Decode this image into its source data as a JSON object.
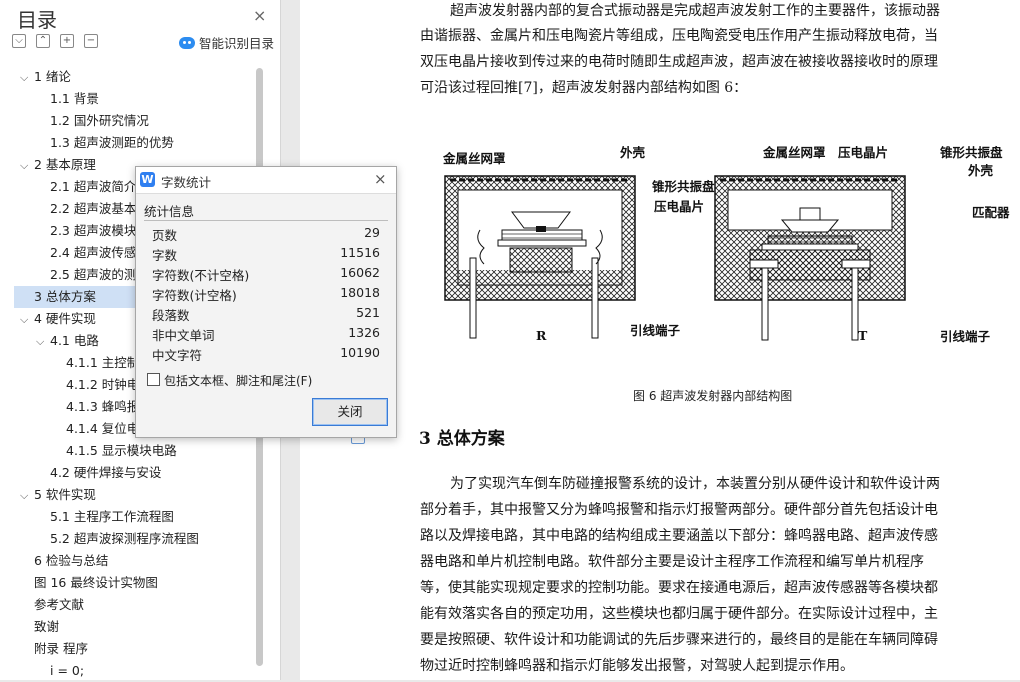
{
  "toc": {
    "title": "目录",
    "close_icon": "×",
    "smart_label": "智能识别目录",
    "tool_icons": [
      "⌵",
      "⌃",
      "+",
      "−"
    ],
    "items": [
      {
        "label": "1  绪论",
        "level": 1,
        "expanded": true
      },
      {
        "label": "1.1  背景",
        "level": 2
      },
      {
        "label": "1.2  国外研究情况",
        "level": 2
      },
      {
        "label": "1.3  超声波测距的优势",
        "level": 2
      },
      {
        "label": "2  基本原理",
        "level": 1,
        "expanded": true
      },
      {
        "label": "2.1  超声波简介",
        "level": 2
      },
      {
        "label": "2.2  超声波基本",
        "level": 2
      },
      {
        "label": "2.3  超声波模块",
        "level": 2
      },
      {
        "label": "2.4  超声波传感",
        "level": 2
      },
      {
        "label": "2.5  超声波的测",
        "level": 2
      },
      {
        "label": "3  总体方案",
        "level": 1,
        "selected": true
      },
      {
        "label": "4  硬件实现",
        "level": 1,
        "expanded": true
      },
      {
        "label": "4.1  电路",
        "level": 2,
        "expanded": true
      },
      {
        "label": "4.1.1  主控制",
        "level": 3
      },
      {
        "label": "4.1.2  时钟电",
        "level": 3
      },
      {
        "label": "4.1.3  蜂鸣报",
        "level": 3
      },
      {
        "label": "4.1.4  复位电",
        "level": 3
      },
      {
        "label": "4.1.5  显示模块电路",
        "level": 3
      },
      {
        "label": "4.2  硬件焊接与安设",
        "level": 2
      },
      {
        "label": "5  软件实现",
        "level": 1,
        "expanded": true
      },
      {
        "label": "5.1  主程序工作流程图",
        "level": 2
      },
      {
        "label": "5.2  超声波探测程序流程图",
        "level": 2
      },
      {
        "label": "6  检验与总结",
        "level": 1
      },
      {
        "label": "图 16  最终设计实物图",
        "level": 1
      },
      {
        "label": "参考文献",
        "level": 1
      },
      {
        "label": "致谢",
        "level": 1
      },
      {
        "label": "附录  程序",
        "level": 1
      },
      {
        "label": "i = 0;",
        "level": 2
      }
    ]
  },
  "dialog": {
    "title": "字数统计",
    "section": "统计信息",
    "stats": [
      {
        "label": "页数",
        "value": "29"
      },
      {
        "label": "字数",
        "value": "11516"
      },
      {
        "label": "字符数(不计空格)",
        "value": "16062"
      },
      {
        "label": "字符数(计空格)",
        "value": "18018"
      },
      {
        "label": "段落数",
        "value": "521"
      },
      {
        "label": "非中文单词",
        "value": "1326"
      },
      {
        "label": "中文字符",
        "value": "10190"
      }
    ],
    "checkbox_label": "包括文本框、脚注和尾注(F)",
    "checkbox_checked": false,
    "close_label": "关闭"
  },
  "document": {
    "intro_lines": [
      "超声波发射器内部的复合式振动器是完成超声波发射工作的主要器件，该振动器",
      "由谐振器、金属片和压电陶瓷片等组成，压电陶瓷受电压作用产生振动释放电荷，当",
      "双压电晶片接收到传过来的电荷时随即生成超声波，超声波在被接收器接收时的原理",
      "可沿该过程回推[7]，超声波发射器内部结构如图 6："
    ],
    "figure": {
      "left_labels": [
        "金属丝网罩",
        "外壳",
        "锥形共振盘",
        "压电晶片",
        "R",
        "引线端子"
      ],
      "right_labels": [
        "金属丝网罩",
        "压电晶片",
        "锥形共振盘",
        "外壳",
        "匹配器",
        "T",
        "引线端子"
      ]
    },
    "caption": "图 6  超声波发射器内部结构图",
    "heading": "3  总体方案",
    "body_lines": [
      "为了实现汽车倒车防碰撞报警系统的设计，本装置分别从硬件设计和软件设计两",
      "部分着手，其中报警又分为蜂鸣报警和指示灯报警两部分。硬件部分首先包括设计电",
      "路以及焊接电路，其中电路的结构组成主要涵盖以下部分：蜂鸣器电路、超声波传感",
      "器电路和单片机控制电路。软件部分主要是设计主程序工作流程和编写单片机程序",
      "等，使其能实现规定要求的控制功能。要求在接通电源后，超声波传感器等各模块都",
      "能有效落实各自的预定功用，这些模块也都归属于硬件部分。在实际设计过程中，主",
      "要是按照硬、软件设计和功能调试的先后步骤来进行的，最终目的是能在车辆同障碍",
      "物过近时控制蜂鸣器和指示灯能够发出报警，对驾驶人起到提示作用。"
    ]
  }
}
